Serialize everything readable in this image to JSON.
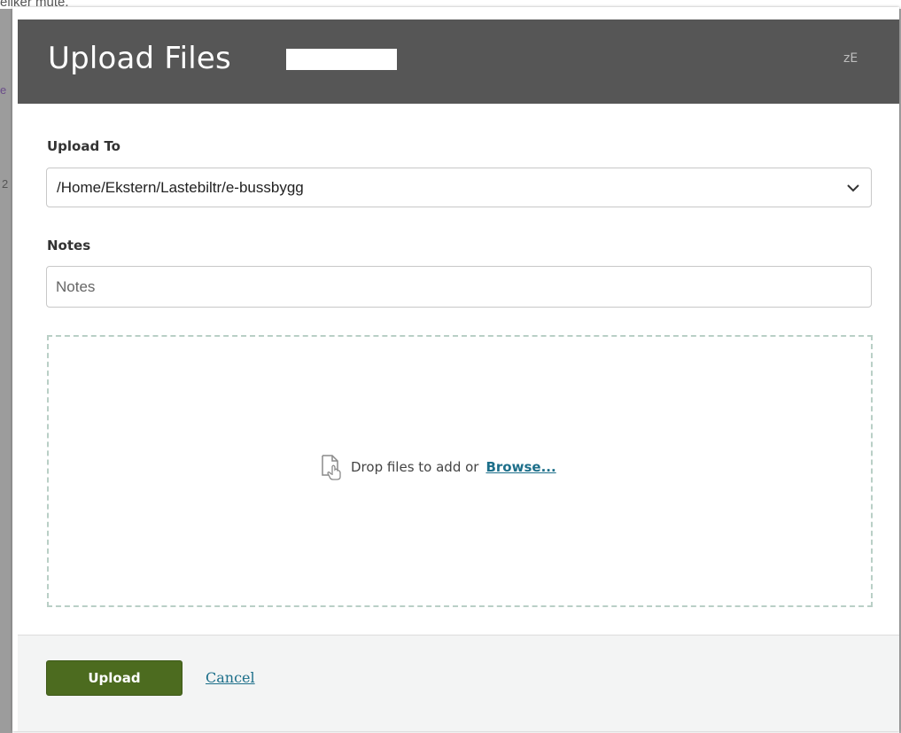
{
  "background": {
    "top_text": "eliker mute.",
    "edge_text_1": "e",
    "edge_text_2": "2"
  },
  "dialog": {
    "title": "Upload Files",
    "header_icon": "zE",
    "upload_to": {
      "label": "Upload To",
      "selected_value": "/Home/Ekstern/Lastebiltr/e-bussbygg",
      "chevron_icon": "chevron-down-icon"
    },
    "notes": {
      "label": "Notes",
      "placeholder": "Notes",
      "value": ""
    },
    "dropzone": {
      "icon": "file-drop-icon",
      "prompt": "Drop files to add or",
      "browse_label": "Browse..."
    },
    "footer": {
      "upload_label": "Upload",
      "cancel_label": "Cancel"
    }
  },
  "colors": {
    "header_bg": "#565656",
    "primary_button": "#4c6b1f",
    "link": "#1d6f8a",
    "dropzone_border": "#b9cfc6",
    "footer_bg": "#f3f4f4"
  }
}
